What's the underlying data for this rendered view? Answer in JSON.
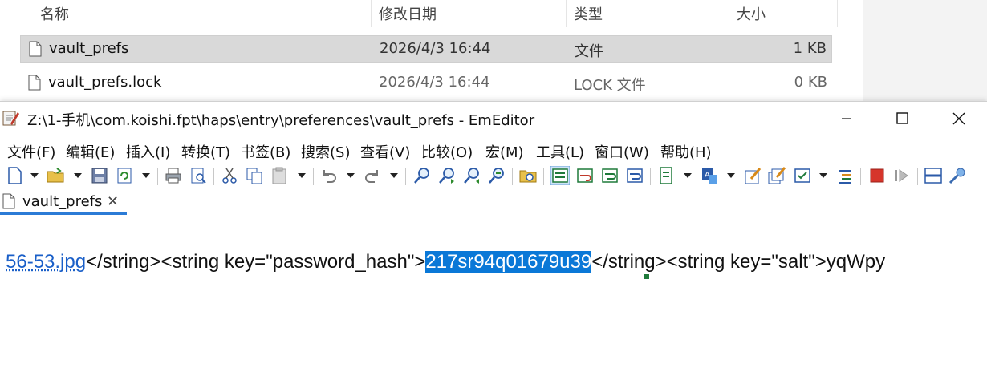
{
  "explorer": {
    "columns": {
      "name": "名称",
      "date": "修改日期",
      "type": "类型",
      "size": "大小"
    },
    "files": [
      {
        "name": "vault_prefs",
        "date": "2026/4/3 16:44",
        "type": "文件",
        "size": "1 KB",
        "selected": true
      },
      {
        "name": "vault_prefs.lock",
        "date": "2026/4/3 16:44",
        "type": "LOCK 文件",
        "size": "0 KB",
        "selected": false
      }
    ]
  },
  "editor": {
    "title": "Z:\\1-手机\\com.koishi.fpt\\haps\\entry\\preferences\\vault_prefs - EmEditor",
    "menu": [
      "文件(F)",
      "编辑(E)",
      "插入(I)",
      "转换(T)",
      "书签(B)",
      "搜索(S)",
      "查看(V)",
      "比较(O)",
      "宏(M)",
      "工具(L)",
      "窗口(W)",
      "帮助(H)"
    ],
    "tab": {
      "label": "vault_prefs",
      "close": "✕"
    },
    "line": {
      "link": "56-53.jpg",
      "before": "</string><string key=\"password_hash\">",
      "selected": "217sr94q01679u39",
      "after": "</string><string key=\"salt\">yqWpy"
    }
  },
  "colors": {
    "selection": "#0a78d7",
    "link": "#1a5fc8",
    "tab_accent": "#2b7bd6"
  }
}
